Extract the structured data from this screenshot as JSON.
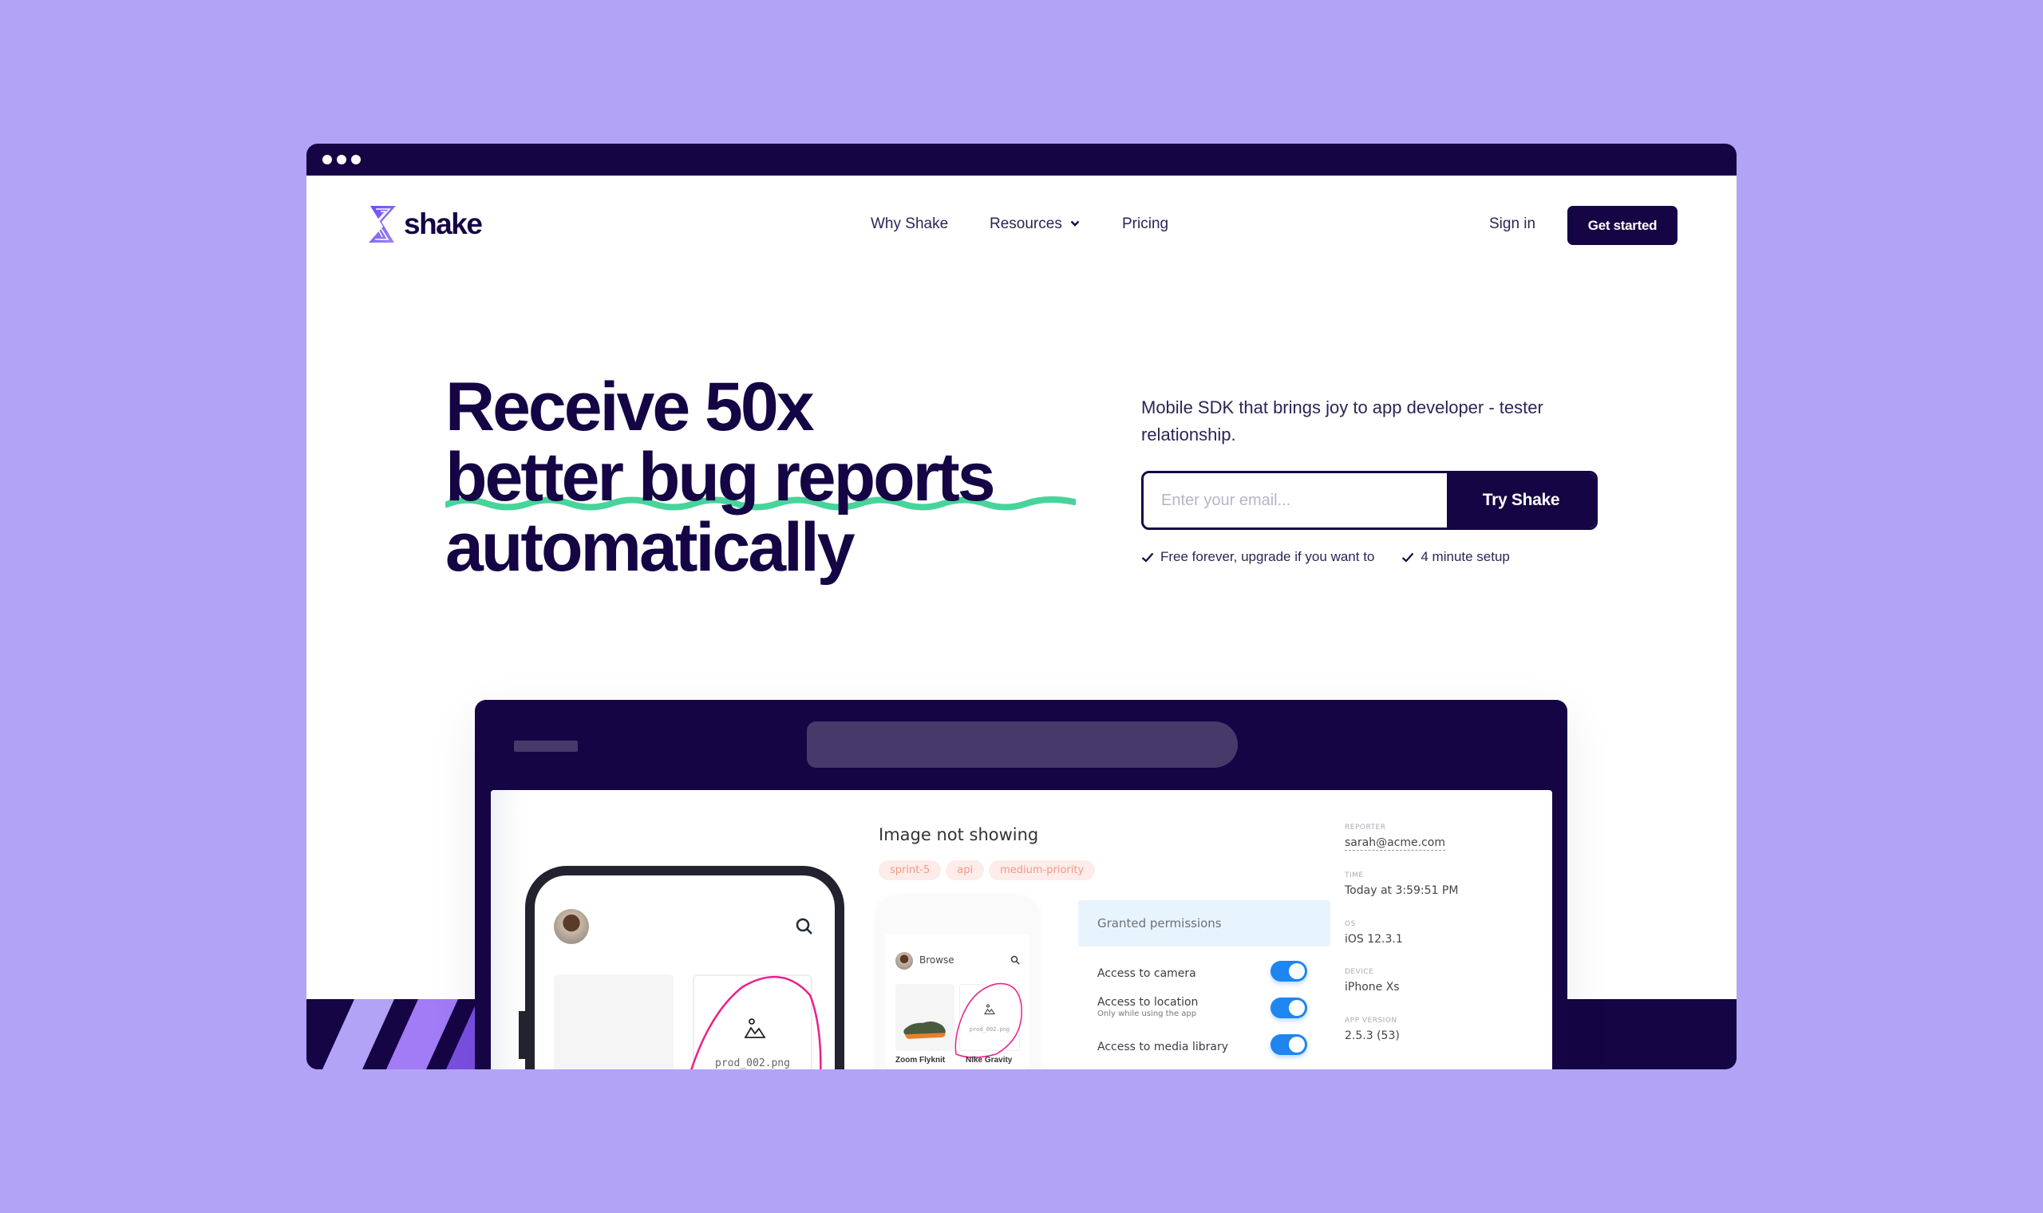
{
  "brand": {
    "name": "shake",
    "colors": {
      "background": "#b2a3f7",
      "primary": "#150545",
      "accent_green": "#47d49a",
      "toggle_blue": "#1f85f0",
      "stripe_light": "#b2a3f7",
      "stripe_mid": "#a27bf7"
    }
  },
  "nav": {
    "links": [
      {
        "label": "Why Shake"
      },
      {
        "label": "Resources",
        "has_dropdown": true,
        "icon": "chevron-down-icon"
      },
      {
        "label": "Pricing"
      }
    ],
    "sign_in": "Sign in",
    "cta": "Get started"
  },
  "hero": {
    "headline": [
      "Receive 50x",
      "better bug reports",
      "automatically"
    ],
    "subtitle": "Mobile SDK that brings joy to app developer - tester relationship.",
    "email": {
      "value": "",
      "placeholder": "Enter your email..."
    },
    "submit": "Try Shake",
    "checks": [
      {
        "icon": "check-icon",
        "label": "Free forever, upgrade if you want to"
      },
      {
        "icon": "check-icon",
        "label": "4 minute setup"
      }
    ]
  },
  "mockup": {
    "issue_title": "Image not showing",
    "tags": [
      "sprint-5",
      "api",
      "medium-priority"
    ],
    "phone": {
      "broken_image_file": "prod_002.png"
    },
    "phone_small": {
      "title": "Browse",
      "file": "prod_002.png",
      "products": [
        "Zoom Flyknit",
        "Nike Gravity"
      ]
    },
    "permissions": {
      "title": "Granted permissions",
      "items": [
        {
          "label": "Access to camera",
          "sub": "",
          "enabled": true
        },
        {
          "label": "Access to location",
          "sub": "Only while using the app",
          "enabled": true
        },
        {
          "label": "Access to media library",
          "sub": "",
          "enabled": true
        }
      ]
    },
    "meta": [
      {
        "label": "REPORTER",
        "value": "sarah@acme.com"
      },
      {
        "label": "TIME",
        "value": "Today at 3:59:51 PM"
      },
      {
        "label": "OS",
        "value": "iOS 12.3.1"
      },
      {
        "label": "DEVICE",
        "value": "iPhone Xs"
      },
      {
        "label": "APP VERSION",
        "value": "2.5.3 (53)"
      }
    ]
  }
}
